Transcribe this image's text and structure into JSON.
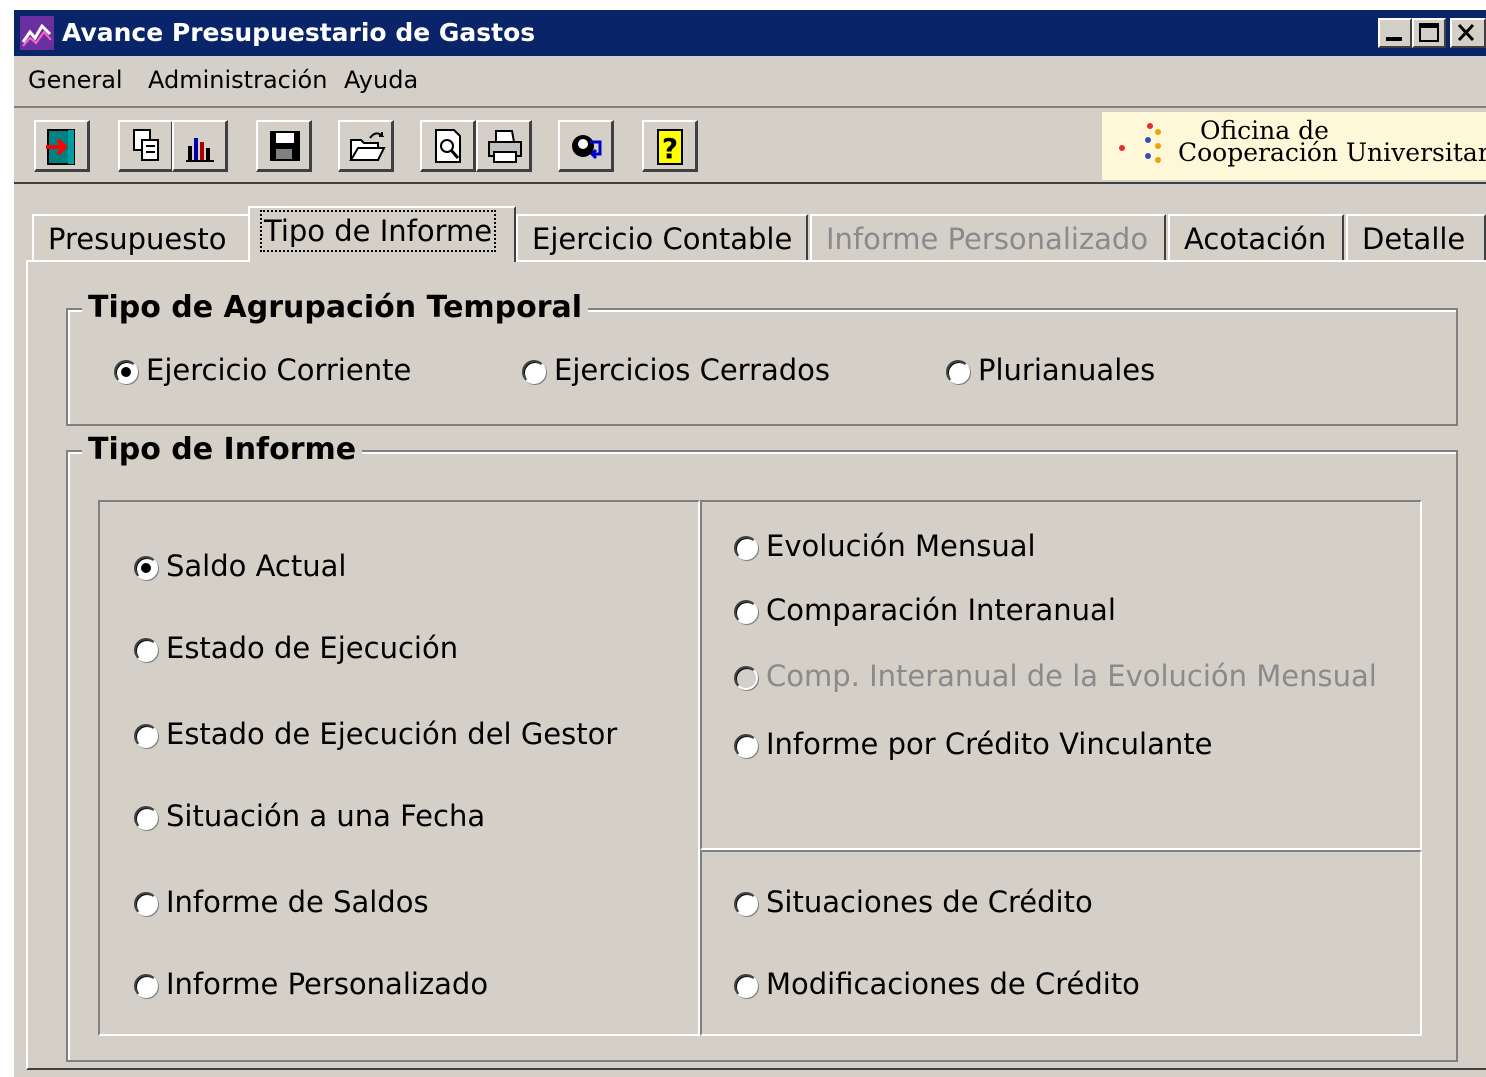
{
  "window": {
    "title": "Avance Presupuestario de Gastos",
    "icon": "chart-line-icon"
  },
  "title_buttons": [
    "minimize-icon",
    "maximize-icon",
    "close-icon"
  ],
  "menu": [
    {
      "label": "General"
    },
    {
      "label": "Administración"
    },
    {
      "label": "Ayuda"
    }
  ],
  "toolbar": {
    "buttons": [
      {
        "name": "exit-icon"
      },
      {
        "name": "copy-icon"
      },
      {
        "name": "bar-chart-icon"
      },
      {
        "name": "save-icon"
      },
      {
        "name": "open-folder-icon"
      },
      {
        "name": "print-preview-icon"
      },
      {
        "name": "printer-icon"
      },
      {
        "name": "user-query-icon"
      },
      {
        "name": "help-icon"
      }
    ],
    "help_glyph": "?"
  },
  "logo": {
    "line1": "Oficina de",
    "line2": "Cooperación Universitaria"
  },
  "tabs": [
    {
      "label": "Presupuesto",
      "state": "normal"
    },
    {
      "label": "Tipo de Informe",
      "state": "active"
    },
    {
      "label": "Ejercicio Contable",
      "state": "normal"
    },
    {
      "label": "Informe Personalizado",
      "state": "disabled"
    },
    {
      "label": "Acotación",
      "state": "normal"
    },
    {
      "label": "Detalle",
      "state": "normal"
    }
  ],
  "agrupacion": {
    "title": "Tipo de Agrupación Temporal",
    "options": [
      {
        "label": "Ejercicio Corriente",
        "checked": true
      },
      {
        "label": "Ejercicios Cerrados",
        "checked": false
      },
      {
        "label": "Plurianuales",
        "checked": false
      }
    ]
  },
  "informe": {
    "title": "Tipo de Informe",
    "left_options": [
      {
        "label": "Saldo Actual",
        "checked": true
      },
      {
        "label": "Estado de Ejecución",
        "checked": false
      },
      {
        "label": "Estado de Ejecución del Gestor",
        "checked": false
      },
      {
        "label": "Situación a una Fecha",
        "checked": false
      },
      {
        "label": "Informe de Saldos",
        "checked": false
      },
      {
        "label": "Informe Personalizado",
        "checked": false
      }
    ],
    "right_top_options": [
      {
        "label": "Evolución Mensual",
        "checked": false,
        "disabled": false
      },
      {
        "label": "Comparación Interanual",
        "checked": false,
        "disabled": false
      },
      {
        "label": "Comp. Interanual de la Evolución Mensual",
        "checked": false,
        "disabled": true
      },
      {
        "label": "Informe por Crédito Vinculante",
        "checked": false,
        "disabled": false
      }
    ],
    "right_bottom_options": [
      {
        "label": "Situaciones de Crédito",
        "checked": false
      },
      {
        "label": "Modificaciones de Crédito",
        "checked": false
      }
    ]
  }
}
